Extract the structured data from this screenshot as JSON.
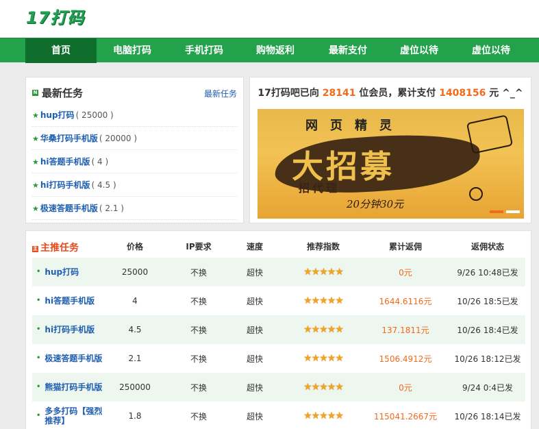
{
  "header": {
    "logo": "17打码"
  },
  "nav": {
    "items": [
      {
        "label": "首页",
        "active": true
      },
      {
        "label": "电脑打码"
      },
      {
        "label": "手机打码"
      },
      {
        "label": "购物返利"
      },
      {
        "label": "最新支付"
      },
      {
        "label": "虚位以待"
      },
      {
        "label": "虚位以待"
      }
    ]
  },
  "latest_tasks": {
    "badge": "N",
    "title": "最新任务",
    "more": "最新任务",
    "items": [
      {
        "name": "hup打码",
        "value": "( 25000 )"
      },
      {
        "name": "华桑打码手机版",
        "value": "( 20000 )"
      },
      {
        "name": "hi答题手机版",
        "value": "( 4 )"
      },
      {
        "name": "hi打码手机版",
        "value": "( 4.5 )"
      },
      {
        "name": "极速答题手机版",
        "value": "( 2.1 )"
      }
    ]
  },
  "banner": {
    "prefix": "17打码吧已向 ",
    "members": "28141",
    "mid": " 位会员，累计支付 ",
    "total_paid": "1408156",
    "suffix": " 元 ^_^",
    "image": {
      "top_text": "网页精灵",
      "big_text": "大招募",
      "mid_text": "招代理",
      "bottom_text": "20分钟30元"
    }
  },
  "main_tasks": {
    "title": "主推任务",
    "columns": [
      "价格",
      "IP要求",
      "速度",
      "推荐指数",
      "累计返佣",
      "返佣状态"
    ],
    "rows": [
      {
        "name": "hup打码",
        "price": "25000",
        "ip": "不换",
        "speed": "超快",
        "stars": "★★★★★",
        "rebate": "0元",
        "status": "9/26 10:48已发"
      },
      {
        "name": "hi答题手机版",
        "price": "4",
        "ip": "不换",
        "speed": "超快",
        "stars": "★★★★★",
        "rebate": "1644.6116元",
        "status": "10/26 18:5已发"
      },
      {
        "name": "hi打码手机版",
        "price": "4.5",
        "ip": "不换",
        "speed": "超快",
        "stars": "★★★★★",
        "rebate": "137.1811元",
        "status": "10/26 18:4已发"
      },
      {
        "name": "极速答题手机版",
        "price": "2.1",
        "ip": "不换",
        "speed": "超快",
        "stars": "★★★★★",
        "rebate": "1506.4912元",
        "status": "10/26 18:12已发"
      },
      {
        "name": "熊猫打码手机版",
        "price": "250000",
        "ip": "不换",
        "speed": "超快",
        "stars": "★★★★★",
        "rebate": "0元",
        "status": "9/24 0:4已发"
      },
      {
        "name": "多多打码【强烈推荐】",
        "price": "1.8",
        "ip": "不换",
        "speed": "超快",
        "stars": "★★★★★",
        "rebate": "115041.2667元",
        "status": "10/26 18:14已发"
      }
    ]
  },
  "colors": {
    "brand_green": "#23a24c",
    "nav_active": "#0f6e2c",
    "accent_orange": "#f26a1b",
    "link_blue": "#1f5fb0"
  }
}
